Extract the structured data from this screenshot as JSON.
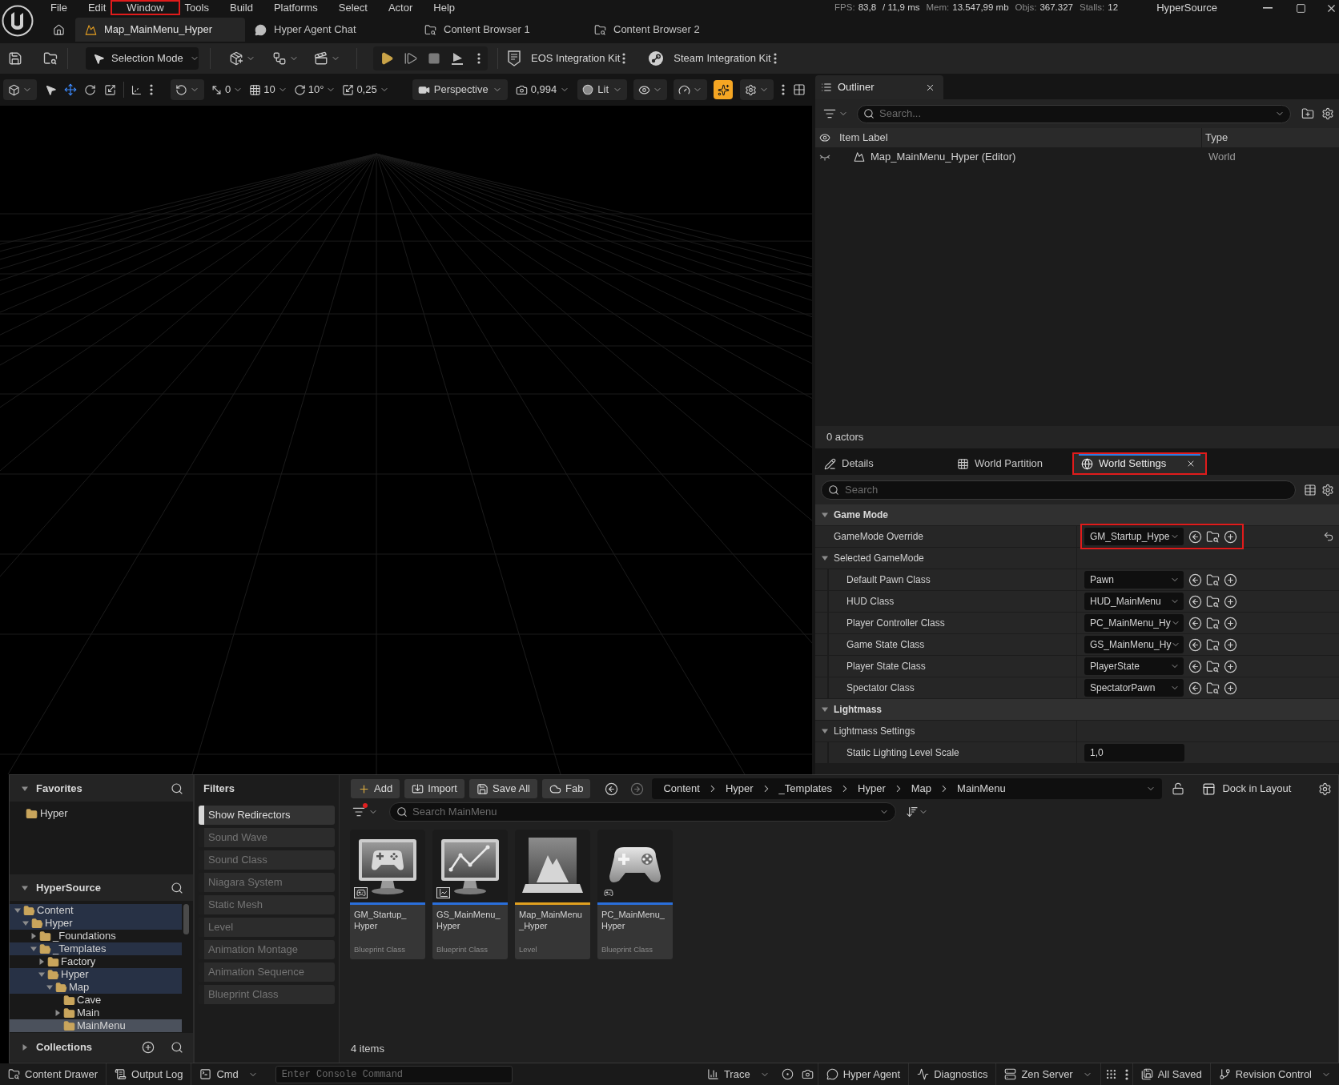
{
  "menu_bar": {
    "items": [
      {
        "label": "File",
        "highlighted": false
      },
      {
        "label": "Edit",
        "highlighted": false
      },
      {
        "label": "Window",
        "highlighted": true
      },
      {
        "label": "Tools",
        "highlighted": false
      },
      {
        "label": "Build",
        "highlighted": false
      },
      {
        "label": "Platforms",
        "highlighted": false
      },
      {
        "label": "Select",
        "highlighted": false
      },
      {
        "label": "Actor",
        "highlighted": false
      },
      {
        "label": "Help",
        "highlighted": false
      }
    ]
  },
  "stats": [
    {
      "label": "FPS:",
      "value": "83,8"
    },
    {
      "value": "/ 11,9 ms"
    },
    {
      "label": "Mem:",
      "value": "13.547,99 mb"
    },
    {
      "label": "Objs:",
      "value": "367.327"
    },
    {
      "label": "Stalls:",
      "value": "12"
    }
  ],
  "project_name": "HyperSource",
  "document_tabs": [
    {
      "kind": "level",
      "label": "Map_MainMenu_Hyper",
      "selected": true
    },
    {
      "kind": "chat",
      "label": "Hyper Agent Chat",
      "selected": false
    },
    {
      "kind": "browser",
      "label": "Content Browser 1",
      "selected": false
    },
    {
      "kind": "browser",
      "label": "Content Browser 2",
      "selected": false
    }
  ],
  "main_toolbar": {
    "mode": "Selection Mode",
    "plugins": [
      {
        "kind": "eos",
        "label": "EOS Integration Kit"
      },
      {
        "kind": "steam",
        "label": "Steam Integration Kit"
      }
    ]
  },
  "viewport_toolbar": {
    "snaps": [
      {
        "kind": "translate",
        "value": "0"
      },
      {
        "kind": "grid",
        "value": "10"
      },
      {
        "kind": "rotate",
        "value": "10°"
      },
      {
        "kind": "scale",
        "value": "0,25"
      }
    ],
    "view": "Perspective",
    "camera_speed": "0,994",
    "lighting": "Lit",
    "quick_toggle": {
      "on": true
    }
  },
  "outliner": {
    "title": "Outliner",
    "search": {
      "placeholder": "Search..."
    },
    "columns": [
      "Item Label",
      "Type"
    ],
    "rows": [
      {
        "label": "Map_MainMenu_Hyper (Editor)",
        "type": "World"
      }
    ],
    "summary": "0 actors"
  },
  "details": {
    "tabs": [
      {
        "kind": "details",
        "label": "Details",
        "selected": false,
        "highlighted": false
      },
      {
        "kind": "partition",
        "label": "World Partition",
        "selected": false,
        "highlighted": false
      },
      {
        "kind": "settings",
        "label": "World Settings",
        "selected": true,
        "highlighted": true
      }
    ],
    "search": {
      "placeholder": "Search"
    },
    "rows": [
      {
        "kind": "section",
        "label": "Game Mode",
        "expanded": true,
        "children": [
          {
            "kind": "class",
            "label": "GameMode Override",
            "value": "GM_Startup_Hype",
            "highlighted": true,
            "resettable": true
          },
          {
            "kind": "group",
            "label": "Selected GameMode",
            "expanded": true,
            "children": [
              {
                "kind": "class",
                "label": "Default Pawn Class",
                "value": "Pawn",
                "highlighted": false,
                "resettable": false
              },
              {
                "kind": "class",
                "label": "HUD Class",
                "value": "HUD_MainMenu",
                "highlighted": false,
                "resettable": false
              },
              {
                "kind": "class",
                "label": "Player Controller Class",
                "value": "PC_MainMenu_Hy",
                "highlighted": false,
                "resettable": false
              },
              {
                "kind": "class",
                "label": "Game State Class",
                "value": "GS_MainMenu_Hy",
                "highlighted": false,
                "resettable": false
              },
              {
                "kind": "class",
                "label": "Player State Class",
                "value": "PlayerState",
                "highlighted": false,
                "resettable": false
              },
              {
                "kind": "class",
                "label": "Spectator Class",
                "value": "SpectatorPawn",
                "highlighted": false,
                "resettable": false
              }
            ]
          }
        ]
      },
      {
        "kind": "section",
        "label": "Lightmass",
        "expanded": true,
        "children": [
          {
            "kind": "group",
            "label": "Lightmass Settings",
            "expanded": true,
            "children": [
              {
                "kind": "number",
                "label": "Static Lighting Level Scale",
                "value": "1,0",
                "highlighted": false,
                "resettable": false
              }
            ]
          }
        ]
      }
    ]
  },
  "content_drawer": {
    "favorites": {
      "title": "Favorites",
      "expanded": true,
      "items": [
        {
          "label": "Hyper"
        }
      ]
    },
    "sources": {
      "title": "HyperSource",
      "expanded": true,
      "tree": [
        {
          "label": "Content",
          "expandable": true,
          "expanded": true,
          "highlighted": true,
          "selected": false,
          "children": [
            {
              "label": "Hyper",
              "expandable": true,
              "expanded": true,
              "highlighted": true,
              "selected": false,
              "children": [
                {
                  "label": "_Foundations",
                  "expandable": true,
                  "expanded": false,
                  "highlighted": false,
                  "selected": false
                },
                {
                  "label": "_Templates",
                  "expandable": true,
                  "expanded": true,
                  "highlighted": true,
                  "selected": false,
                  "children": [
                    {
                      "label": "Factory",
                      "expandable": true,
                      "expanded": false,
                      "highlighted": false,
                      "selected": false
                    },
                    {
                      "label": "Hyper",
                      "expandable": true,
                      "expanded": true,
                      "highlighted": true,
                      "selected": false,
                      "children": [
                        {
                          "label": "Map",
                          "expandable": true,
                          "expanded": true,
                          "highlighted": true,
                          "selected": false,
                          "children": [
                            {
                              "label": "Cave",
                              "expandable": false,
                              "expanded": false,
                              "highlighted": false,
                              "selected": false
                            },
                            {
                              "label": "Main",
                              "expandable": true,
                              "expanded": false,
                              "highlighted": false,
                              "selected": false
                            },
                            {
                              "label": "MainMenu",
                              "expandable": false,
                              "expanded": false,
                              "highlighted": false,
                              "selected": true
                            }
                          ]
                        }
                      ]
                    }
                  ]
                }
              ]
            }
          ]
        }
      ]
    },
    "collections": {
      "title": "Collections",
      "expanded": false
    },
    "filters": {
      "title": "Filters",
      "items": [
        {
          "label": "Show Redirectors",
          "active": true
        },
        {
          "label": "Sound Wave",
          "active": false
        },
        {
          "label": "Sound Class",
          "active": false
        },
        {
          "label": "Niagara System",
          "active": false
        },
        {
          "label": "Static Mesh",
          "active": false
        },
        {
          "label": "Level",
          "active": false
        },
        {
          "label": "Animation Montage",
          "active": false
        },
        {
          "label": "Animation Sequence",
          "active": false
        },
        {
          "label": "Blueprint Class",
          "active": false
        }
      ]
    },
    "actions": [
      {
        "kind": "add",
        "label": "Add"
      },
      {
        "kind": "import",
        "label": "Import"
      },
      {
        "kind": "save",
        "label": "Save All"
      },
      {
        "kind": "fab",
        "label": "Fab"
      }
    ],
    "path": [
      "Content",
      "Hyper",
      "_Templates",
      "Hyper",
      "Map",
      "MainMenu"
    ],
    "dock": "Dock in Layout",
    "filter_button": {
      "active": true
    },
    "search": {
      "placeholder": "Search MainMenu"
    },
    "assets": [
      {
        "kind": "game_mode",
        "name": "GM_Startup_Hyper",
        "type": "Blueprint Class",
        "color": "#2a6fdb"
      },
      {
        "kind": "game_state",
        "name": "GS_MainMenu_Hyper",
        "type": "Blueprint Class",
        "color": "#2a6fdb"
      },
      {
        "kind": "level",
        "name": "Map_MainMenu_Hyper",
        "type": "Level",
        "color": "#e0a020"
      },
      {
        "kind": "controller",
        "name": "PC_MainMenu_Hyper",
        "type": "Blueprint Class",
        "color": "#2a6fdb"
      }
    ],
    "count": "4 items"
  },
  "status_bar": {
    "left": [
      {
        "kind": "drawer",
        "label": "Content Drawer",
        "dropdown": false
      },
      {
        "kind": "log",
        "label": "Output Log",
        "dropdown": false
      },
      {
        "kind": "cmd",
        "label": "Cmd",
        "dropdown": true
      }
    ],
    "console": {
      "placeholder": "Enter Console Command"
    },
    "right": [
      {
        "kind": "trace",
        "label": "Trace",
        "dropdown": true
      },
      {
        "kind": "record"
      },
      {
        "kind": "screenshot"
      },
      {
        "kind": "agent",
        "label": "Hyper Agent",
        "dropdown": false
      },
      {
        "kind": "diagnostics",
        "label": "Diagnostics",
        "dropdown": false
      },
      {
        "kind": "zen",
        "label": "Zen Server",
        "dropdown": true
      },
      {
        "kind": "insights"
      },
      {
        "kind": "more"
      },
      {
        "kind": "saved",
        "label": "All Saved",
        "dropdown": false
      },
      {
        "kind": "revision",
        "label": "Revision Control",
        "dropdown": true
      }
    ]
  }
}
